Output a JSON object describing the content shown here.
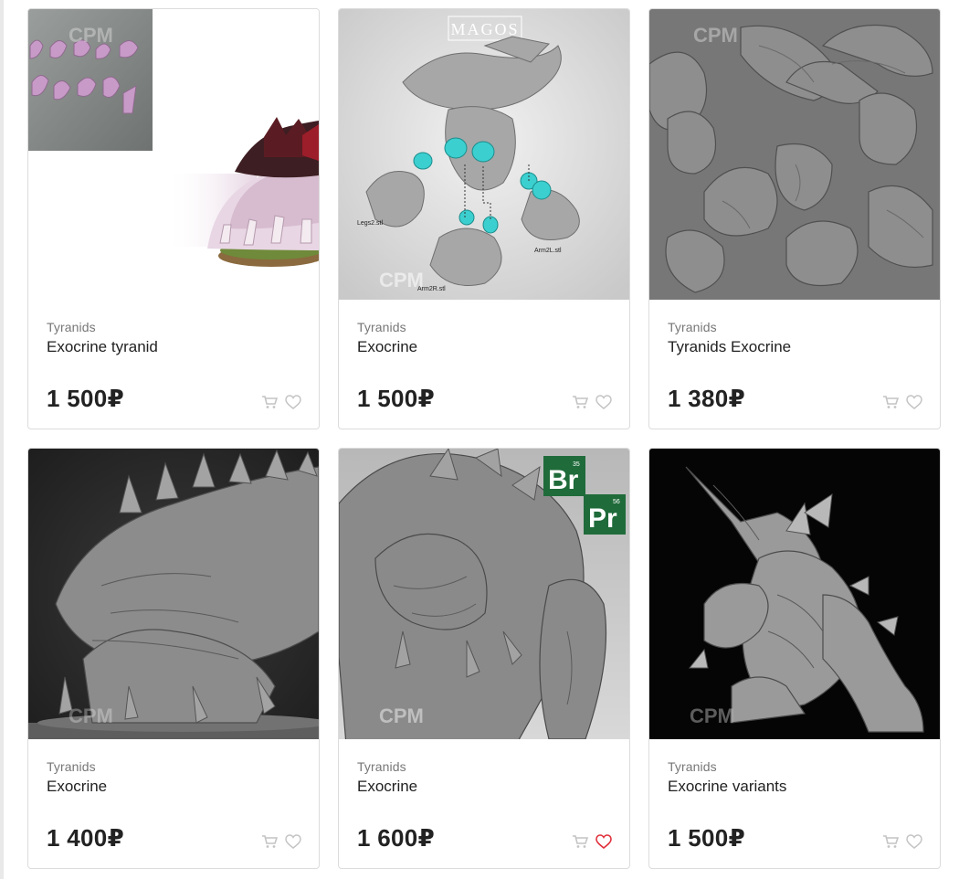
{
  "currency": "₽",
  "colors": {
    "card_border": "#dcdcdc",
    "category_text": "#777777",
    "title_text": "#222222",
    "icon_inactive": "#c4c4c4",
    "favorite_active": "#e0303c"
  },
  "products": [
    {
      "category": "Tyranids",
      "title": "Exocrine tyranid",
      "price": "1 500₽",
      "image_watermark": "CPM",
      "image_icon": "pink-tyranid-model",
      "favorite": false
    },
    {
      "category": "Tyranids",
      "title": "Exocrine",
      "price": "1 500₽",
      "image_watermark": "CPM",
      "image_header": "MAGOS",
      "image_labels": [
        "Legs2.stl",
        "Arm2L.stl",
        "Arm2R.stl"
      ],
      "favorite": false
    },
    {
      "category": "Tyranids",
      "title": "Tyranids Exocrine",
      "price": "1 380₽",
      "image_watermark": "CPM",
      "image_icon": "grey-parts-layout",
      "favorite": false
    },
    {
      "category": "Tyranids",
      "title": "Exocrine",
      "price": "1 400₽",
      "image_watermark": "CPM",
      "image_icon": "dark-render-model",
      "favorite": false
    },
    {
      "category": "Tyranids",
      "title": "Exocrine",
      "price": "1 600₽",
      "image_watermark": "CPM",
      "image_badges": [
        {
          "symbol": "Br",
          "number": "35"
        },
        {
          "symbol": "Pr",
          "number": "56"
        }
      ],
      "favorite": true
    },
    {
      "category": "Tyranids",
      "title": "Exocrine variants",
      "price": "1 500₽",
      "image_watermark": "CPM",
      "image_icon": "black-bg-render",
      "favorite": false
    }
  ]
}
